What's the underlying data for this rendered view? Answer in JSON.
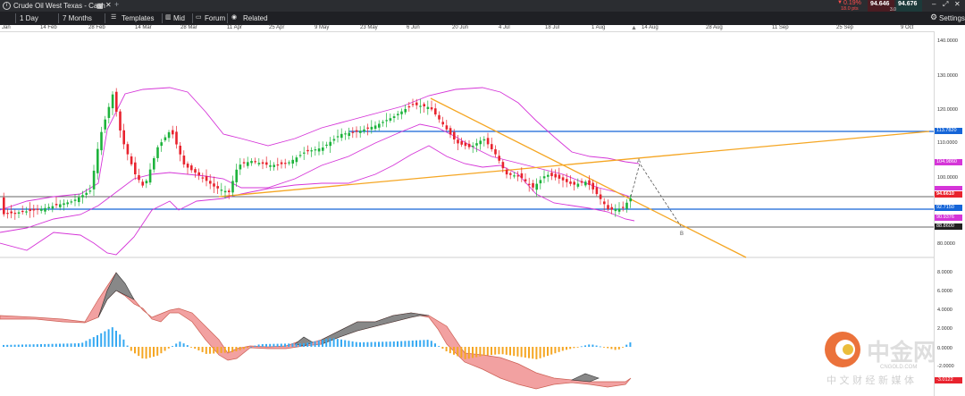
{
  "header": {
    "symbol": "Crude Oil West Texas - Cash",
    "change_pct": "0.19%",
    "change_pts": "18.0 pts",
    "bid": "94.646",
    "spread": "3.0",
    "ask": "94.676"
  },
  "toolbar": {
    "interval": "1 Day",
    "range": "7 Months",
    "templates": "Templates",
    "mid": "Mid",
    "forum": "Forum",
    "related": "Related",
    "settings": "Settings"
  },
  "date_axis": [
    "Jan",
    "14 Feb",
    "28 Feb",
    "14 Mar",
    "28 Mar",
    "11 Apr",
    "25 Apr",
    "9 May",
    "23 May",
    "6 Jun",
    "20 Jun",
    "4 Jul",
    "18 Jul",
    "1 Aug",
    "14 Aug",
    "28 Aug",
    "11 Sep",
    "25 Sep",
    "9 Oct"
  ],
  "price_axis": [
    "140.0000",
    "130.0000",
    "120.0000",
    "110.0000",
    "100.0000",
    "90.0000",
    "80.0000"
  ],
  "price_tags": {
    "upper_blue": "113.7820",
    "upper_band": "104.9860",
    "current": "94.6610",
    "lower_blue": "92.7150",
    "lower_band": "90.9376",
    "black_line": "88.8600"
  },
  "macd_axis": [
    "8.0000",
    "6.0000",
    "4.0000",
    "2.0000",
    "0.0000",
    "-2.0000"
  ],
  "macd_tag": "-3.0122",
  "annotations": {
    "a": "A",
    "b": "B"
  },
  "colors": {
    "up_candle": "#1db33c",
    "down_candle": "#e8232e",
    "bollinger": "#d535d8",
    "trendline": "#f5a623",
    "hline_blue": "#1565d8",
    "hist_pos": "#36a9f2",
    "hist_neg": "#f5a623"
  },
  "watermark": {
    "brand": "中金网",
    "domain": "CNGOLD.COM",
    "slogan": "中 文 财 经 新 媒 体"
  }
}
